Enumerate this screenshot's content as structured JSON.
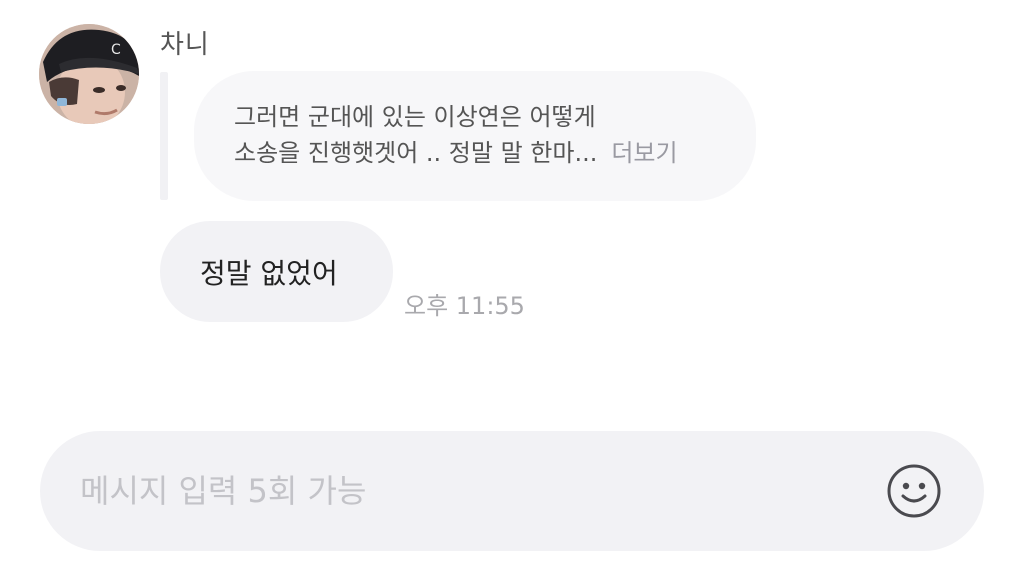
{
  "conversation": {
    "sender_name": "차니",
    "avatar_icon": "profile-photo-avatar",
    "quoted_message": {
      "line1": "그러면 군대에 있는 이상연은 어떻게",
      "line2": "소송을 진행햇겟어 .. 정말 말 한마...",
      "more_label": "더보기"
    },
    "message": {
      "text": "정말 없었어",
      "time": "오후 11:55"
    }
  },
  "composer": {
    "placeholder": "메시지 입력 5회 가능",
    "emoji_icon": "smiley-face-icon"
  },
  "colors": {
    "bubble_bg": "#f2f2f5",
    "quoted_bg": "#f7f7f9",
    "muted_text": "#a9a9ad"
  }
}
